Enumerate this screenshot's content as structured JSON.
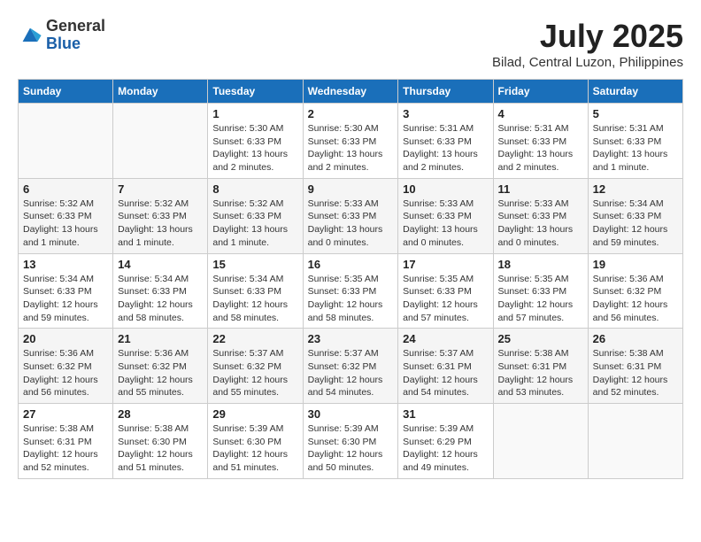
{
  "logo": {
    "general": "General",
    "blue": "Blue"
  },
  "title": "July 2025",
  "location": "Bilad, Central Luzon, Philippines",
  "days_of_week": [
    "Sunday",
    "Monday",
    "Tuesday",
    "Wednesday",
    "Thursday",
    "Friday",
    "Saturday"
  ],
  "weeks": [
    [
      {
        "day": "",
        "info": ""
      },
      {
        "day": "",
        "info": ""
      },
      {
        "day": "1",
        "info": "Sunrise: 5:30 AM\nSunset: 6:33 PM\nDaylight: 13 hours and 2 minutes."
      },
      {
        "day": "2",
        "info": "Sunrise: 5:30 AM\nSunset: 6:33 PM\nDaylight: 13 hours and 2 minutes."
      },
      {
        "day": "3",
        "info": "Sunrise: 5:31 AM\nSunset: 6:33 PM\nDaylight: 13 hours and 2 minutes."
      },
      {
        "day": "4",
        "info": "Sunrise: 5:31 AM\nSunset: 6:33 PM\nDaylight: 13 hours and 2 minutes."
      },
      {
        "day": "5",
        "info": "Sunrise: 5:31 AM\nSunset: 6:33 PM\nDaylight: 13 hours and 1 minute."
      }
    ],
    [
      {
        "day": "6",
        "info": "Sunrise: 5:32 AM\nSunset: 6:33 PM\nDaylight: 13 hours and 1 minute."
      },
      {
        "day": "7",
        "info": "Sunrise: 5:32 AM\nSunset: 6:33 PM\nDaylight: 13 hours and 1 minute."
      },
      {
        "day": "8",
        "info": "Sunrise: 5:32 AM\nSunset: 6:33 PM\nDaylight: 13 hours and 1 minute."
      },
      {
        "day": "9",
        "info": "Sunrise: 5:33 AM\nSunset: 6:33 PM\nDaylight: 13 hours and 0 minutes."
      },
      {
        "day": "10",
        "info": "Sunrise: 5:33 AM\nSunset: 6:33 PM\nDaylight: 13 hours and 0 minutes."
      },
      {
        "day": "11",
        "info": "Sunrise: 5:33 AM\nSunset: 6:33 PM\nDaylight: 13 hours and 0 minutes."
      },
      {
        "day": "12",
        "info": "Sunrise: 5:34 AM\nSunset: 6:33 PM\nDaylight: 12 hours and 59 minutes."
      }
    ],
    [
      {
        "day": "13",
        "info": "Sunrise: 5:34 AM\nSunset: 6:33 PM\nDaylight: 12 hours and 59 minutes."
      },
      {
        "day": "14",
        "info": "Sunrise: 5:34 AM\nSunset: 6:33 PM\nDaylight: 12 hours and 58 minutes."
      },
      {
        "day": "15",
        "info": "Sunrise: 5:34 AM\nSunset: 6:33 PM\nDaylight: 12 hours and 58 minutes."
      },
      {
        "day": "16",
        "info": "Sunrise: 5:35 AM\nSunset: 6:33 PM\nDaylight: 12 hours and 58 minutes."
      },
      {
        "day": "17",
        "info": "Sunrise: 5:35 AM\nSunset: 6:33 PM\nDaylight: 12 hours and 57 minutes."
      },
      {
        "day": "18",
        "info": "Sunrise: 5:35 AM\nSunset: 6:33 PM\nDaylight: 12 hours and 57 minutes."
      },
      {
        "day": "19",
        "info": "Sunrise: 5:36 AM\nSunset: 6:32 PM\nDaylight: 12 hours and 56 minutes."
      }
    ],
    [
      {
        "day": "20",
        "info": "Sunrise: 5:36 AM\nSunset: 6:32 PM\nDaylight: 12 hours and 56 minutes."
      },
      {
        "day": "21",
        "info": "Sunrise: 5:36 AM\nSunset: 6:32 PM\nDaylight: 12 hours and 55 minutes."
      },
      {
        "day": "22",
        "info": "Sunrise: 5:37 AM\nSunset: 6:32 PM\nDaylight: 12 hours and 55 minutes."
      },
      {
        "day": "23",
        "info": "Sunrise: 5:37 AM\nSunset: 6:32 PM\nDaylight: 12 hours and 54 minutes."
      },
      {
        "day": "24",
        "info": "Sunrise: 5:37 AM\nSunset: 6:31 PM\nDaylight: 12 hours and 54 minutes."
      },
      {
        "day": "25",
        "info": "Sunrise: 5:38 AM\nSunset: 6:31 PM\nDaylight: 12 hours and 53 minutes."
      },
      {
        "day": "26",
        "info": "Sunrise: 5:38 AM\nSunset: 6:31 PM\nDaylight: 12 hours and 52 minutes."
      }
    ],
    [
      {
        "day": "27",
        "info": "Sunrise: 5:38 AM\nSunset: 6:31 PM\nDaylight: 12 hours and 52 minutes."
      },
      {
        "day": "28",
        "info": "Sunrise: 5:38 AM\nSunset: 6:30 PM\nDaylight: 12 hours and 51 minutes."
      },
      {
        "day": "29",
        "info": "Sunrise: 5:39 AM\nSunset: 6:30 PM\nDaylight: 12 hours and 51 minutes."
      },
      {
        "day": "30",
        "info": "Sunrise: 5:39 AM\nSunset: 6:30 PM\nDaylight: 12 hours and 50 minutes."
      },
      {
        "day": "31",
        "info": "Sunrise: 5:39 AM\nSunset: 6:29 PM\nDaylight: 12 hours and 49 minutes."
      },
      {
        "day": "",
        "info": ""
      },
      {
        "day": "",
        "info": ""
      }
    ]
  ]
}
